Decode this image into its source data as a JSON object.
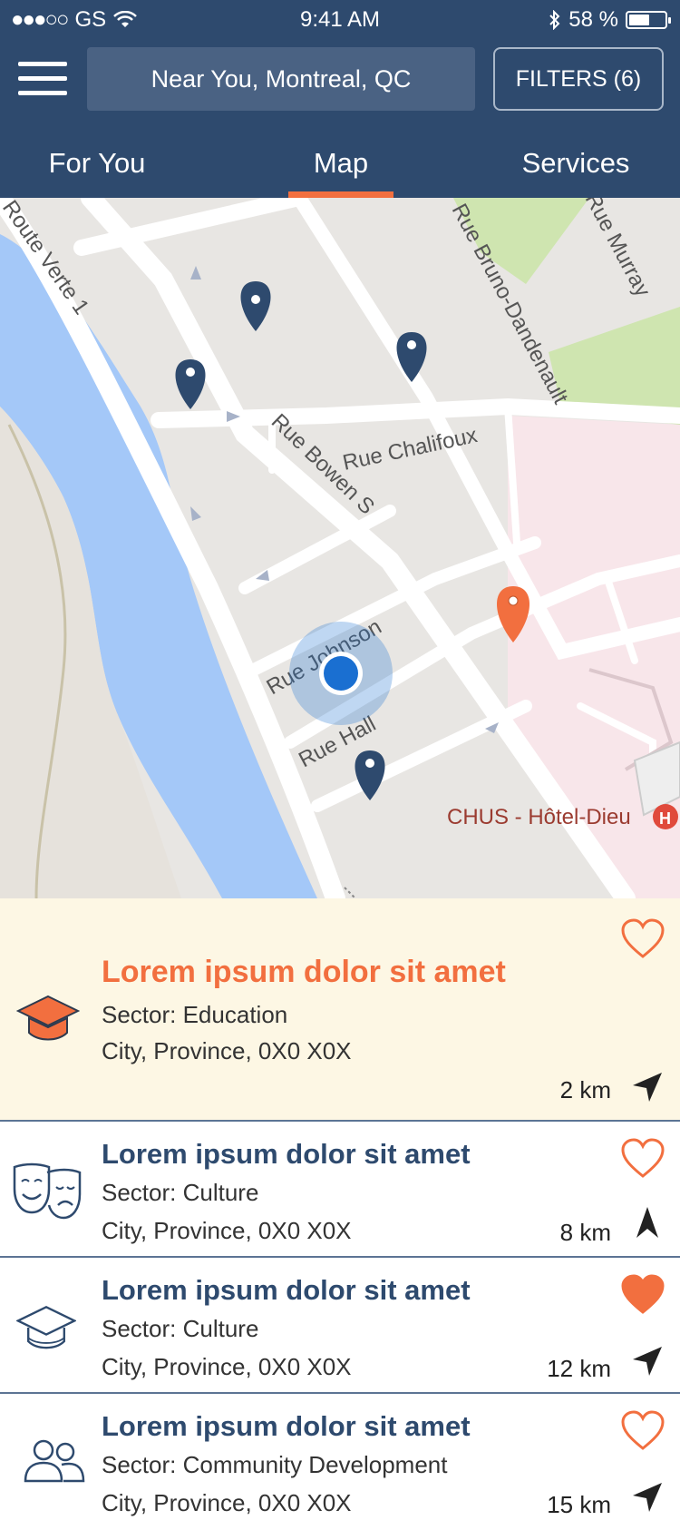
{
  "status_bar": {
    "carrier": "GS",
    "time": "9:41 AM",
    "battery_text": "58 %",
    "battery_level_percent": 58,
    "signal_icon": "signal-dots-icon",
    "wifi_icon": "wifi-icon",
    "bluetooth_icon": "bluetooth-icon"
  },
  "header": {
    "menu_icon": "hamburger-menu-icon",
    "search_text": "Near You, Montreal, QC",
    "filters_label": "FILTERS (6)"
  },
  "tabs": [
    {
      "label": "For You",
      "active": false
    },
    {
      "label": "Map",
      "active": true
    },
    {
      "label": "Services",
      "active": false
    }
  ],
  "map": {
    "street_labels": [
      "Route Verte 1",
      "Rue Bowen S",
      "Rue Chalifoux",
      "Rue Bruno-Dandenault",
      "Rue Murray",
      "Rue Johnson",
      "Rue Hall"
    ],
    "poi_label": "CHUS - Hôtel-Dieu",
    "colors": {
      "marker": "#2e4a6e",
      "marker_selected": "#f26f3f",
      "water": "#a4c8f8",
      "park": "#cfe5b0",
      "user_location": "#1a6fd1"
    }
  },
  "results": [
    {
      "title": "Lorem ipsum dolor sit amet",
      "sector": "Sector: Education",
      "address": "City, Province, 0X0 X0X",
      "distance": "2 km",
      "category_icon": "graduation-cap-icon",
      "favorite": false,
      "featured": true,
      "direction_icon": "navigation-arrow-icon"
    },
    {
      "title": "Lorem ipsum dolor sit amet",
      "sector": "Sector: Culture",
      "address": "City, Province, 0X0 X0X",
      "distance": "8 km",
      "category_icon": "theater-masks-icon",
      "favorite": false,
      "featured": false,
      "direction_icon": "navigation-arrow-icon"
    },
    {
      "title": "Lorem ipsum dolor sit amet",
      "sector": "Sector: Culture",
      "address": "City, Province, 0X0 X0X",
      "distance": "12 km",
      "category_icon": "graduation-cap-icon",
      "favorite": true,
      "featured": false,
      "direction_icon": "navigation-arrow-icon"
    },
    {
      "title": "Lorem ipsum dolor sit amet",
      "sector": "Sector: Community Development",
      "address": "City, Province, 0X0 X0X",
      "distance": "15 km",
      "category_icon": "people-icon",
      "favorite": false,
      "featured": false,
      "direction_icon": "navigation-arrow-icon"
    }
  ]
}
